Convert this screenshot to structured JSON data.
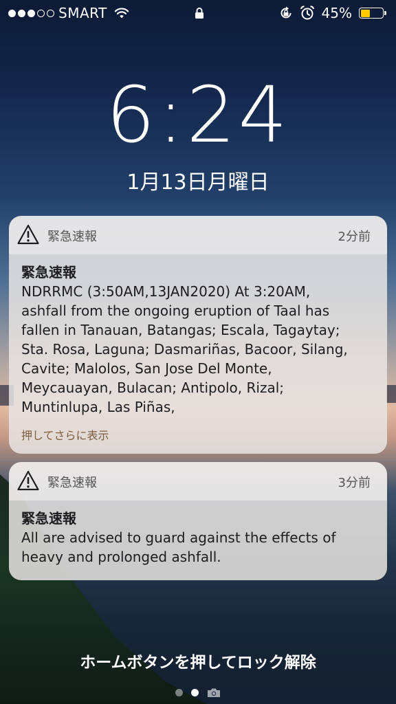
{
  "status_bar": {
    "carrier": "SMART",
    "battery_percent": "45%",
    "battery_level": 0.45,
    "signal_bars_filled": 3,
    "signal_bars_total": 5
  },
  "lock_screen": {
    "time": "6:24",
    "date": "1月13日月曜日",
    "unlock_hint": "ホームボタンを押してロック解除"
  },
  "notifications": [
    {
      "app_name": "緊急速報",
      "time_ago": "2分前",
      "title": "緊急速報",
      "lines": [
        "NDRRMC (3:50AM,13JAN2020) At 3:20AM,",
        "ashfall from the ongoing eruption of Taal has",
        "fallen in Tanauan, Batangas; Escala, Tagaytay;",
        "Sta. Rosa, Laguna; Dasmariñas, Bacoor, Silang,",
        "Cavite; Malolos, San Jose Del Monte,",
        "Meycauayan, Bulacan; Antipolo, Rizal;",
        "Muntinlupa, Las Piñas,"
      ],
      "more_label": "押してさらに表示"
    },
    {
      "app_name": "緊急速報",
      "time_ago": "3分前",
      "title": "緊急速報",
      "lines": [
        "All are advised to guard against the effects of",
        "heavy and prolonged ashfall."
      ]
    }
  ],
  "colors": {
    "battery_fill": "#ffcc00",
    "more_link": "#7d5d3e"
  },
  "icons": [
    "signal-dots-icon",
    "wifi-icon",
    "lock-icon",
    "rotation-lock-icon",
    "alarm-icon",
    "battery-icon",
    "warning-icon",
    "camera-icon"
  ]
}
